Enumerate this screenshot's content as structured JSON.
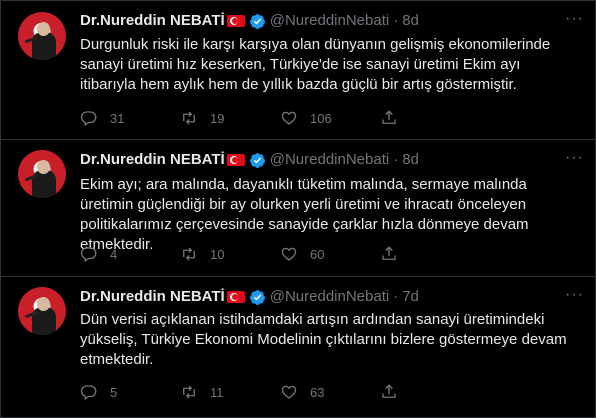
{
  "tweets": [
    {
      "name": "Dr.Nureddin NEBATİ",
      "handle": "@NureddinNebati",
      "dot": "·",
      "time": "8d",
      "text": "Durgunluk riski ile karşı karşıya olan dünyanın gelişmiş ekonomilerinde sanayi üretimi hız keserken, Türkiye'de ise sanayi üretimi Ekim ayı itibarıyla hem aylık hem de yıllık bazda güçlü bir artış göstermiştir.",
      "replies": "31",
      "retweets": "19",
      "likes": "106"
    },
    {
      "name": "Dr.Nureddin NEBATİ",
      "handle": "@NureddinNebati",
      "dot": "·",
      "time": "8d",
      "text": "Ekim ayı; ara malında, dayanıklı tüketim malında, sermaye malında üretimin güçlendiği bir ay olurken yerli üretimi ve ihracatı önceleyen politikalarımız çerçevesinde sanayide çarklar hızla dönmeye devam etmektedir.",
      "replies": "4",
      "retweets": "10",
      "likes": "60"
    },
    {
      "name": "Dr.Nureddin NEBATİ",
      "handle": "@NureddinNebati",
      "dot": "·",
      "time": "7d",
      "text": "Dün verisi açıklanan istihdamdaki artışın ardından sanayi üretimindeki yükseliş, Türkiye Ekonomi Modelinin çıktılarını bizlere göstermeye devam etmektedir.",
      "replies": "5",
      "retweets": "11",
      "likes": "63"
    }
  ],
  "icons": {
    "reply": "reply-icon",
    "retweet": "retweet-icon",
    "like": "heart-icon",
    "share": "share-icon",
    "verified": "verified-badge-icon",
    "flag": "turkey-flag-icon",
    "more": "more-options-icon"
  },
  "colors": {
    "background": "#000000",
    "text": "#e7e9ea",
    "secondary": "#71767b",
    "verified": "#1d9bf0",
    "flag": "#e30a17"
  }
}
